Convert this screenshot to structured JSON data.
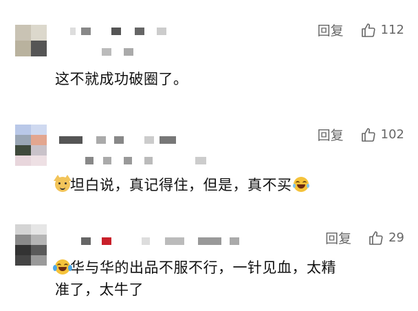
{
  "reply_label": "回复",
  "comments": [
    {
      "text": "这不就成功破圈了。",
      "likes": "112"
    },
    {
      "text": "坦白说，真记得住，但是，真不买",
      "likes": "102",
      "lead_emoji": "cat-face-emoji",
      "trail_emoji": "laughing-emoji"
    },
    {
      "text_line1": "华与华的出品不服不行，一针见血，太精",
      "text_line2": "准了，太牛了",
      "likes": "29",
      "lead_emoji": "crying-laughing-emoji"
    }
  ]
}
